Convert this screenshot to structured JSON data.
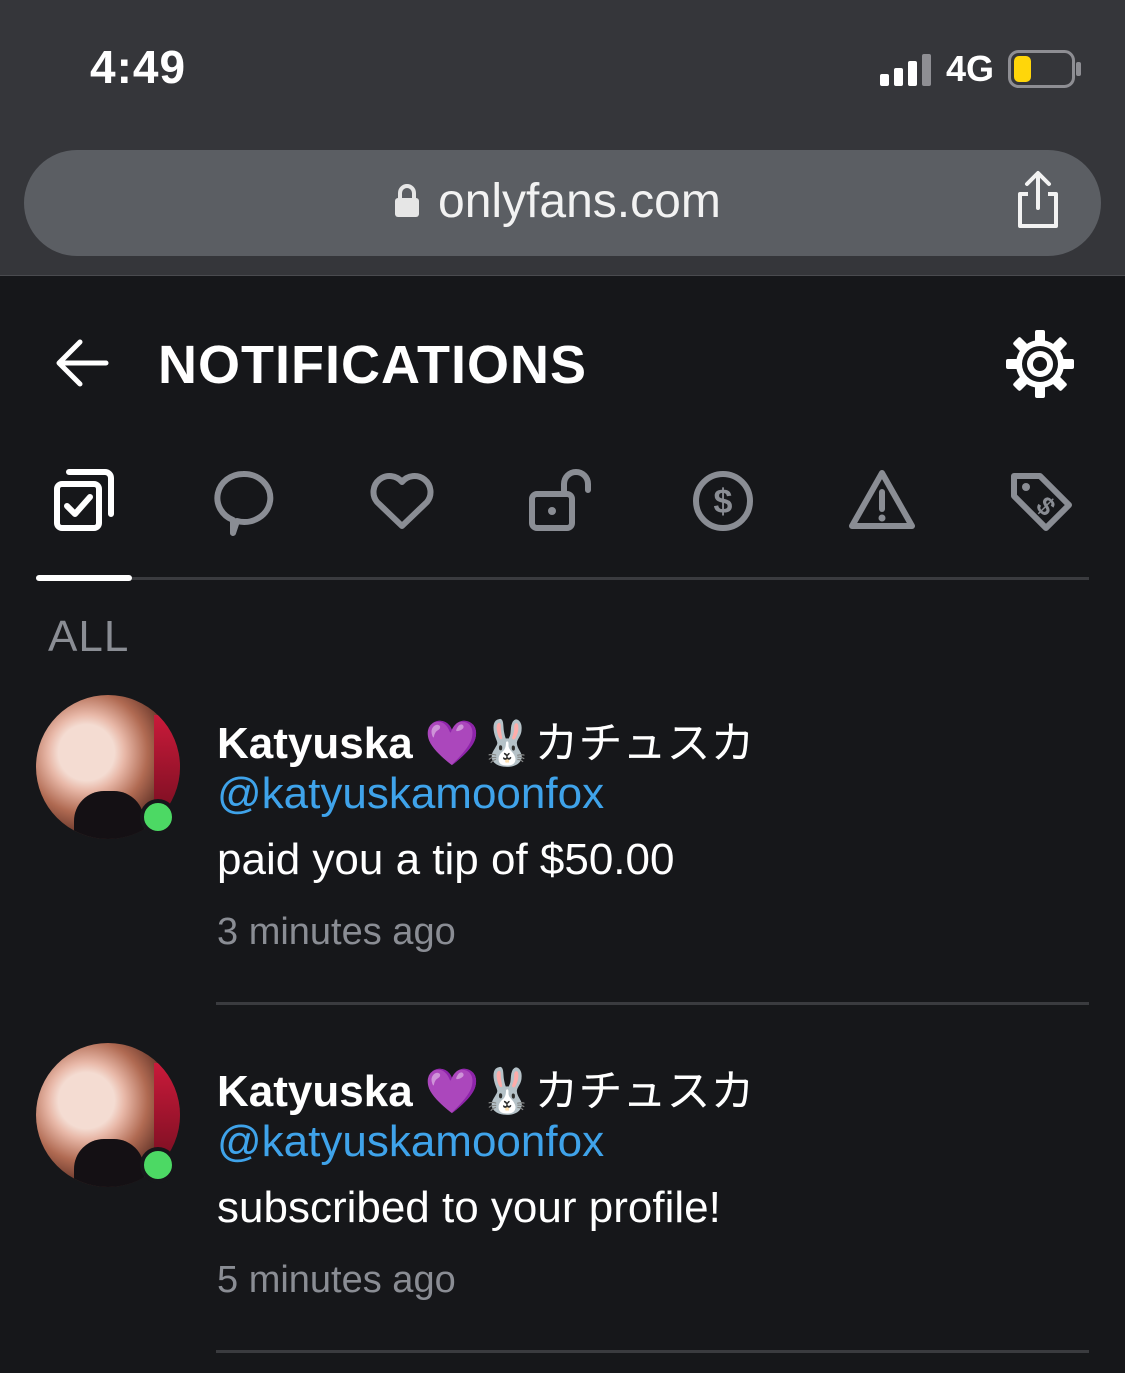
{
  "status_bar": {
    "time": "4:49",
    "network": "4G",
    "battery_level": 0.3,
    "battery_color": "#ffd60a"
  },
  "browser": {
    "url": "onlyfans.com",
    "lock_icon": "lock-icon",
    "share_icon": "share-icon"
  },
  "header": {
    "title": "NOTIFICATIONS",
    "back_icon": "back-arrow-icon",
    "settings_icon": "gear-icon"
  },
  "tabs": [
    {
      "name": "all",
      "icon": "checkbox-stack-icon",
      "active": true
    },
    {
      "name": "comments",
      "icon": "chat-bubble-icon",
      "active": false
    },
    {
      "name": "likes",
      "icon": "heart-icon",
      "active": false
    },
    {
      "name": "subscriptions",
      "icon": "unlock-icon",
      "active": false
    },
    {
      "name": "tips",
      "icon": "dollar-circle-icon",
      "active": false
    },
    {
      "name": "alerts",
      "icon": "warning-icon",
      "active": false
    },
    {
      "name": "promotions",
      "icon": "price-tag-icon",
      "active": false
    }
  ],
  "section": {
    "label": "ALL"
  },
  "notifications": [
    {
      "name": "Katyuska",
      "name_suffix": "カチュスカ",
      "emoji": [
        "💜",
        "🐰"
      ],
      "handle": "@katyuskamoonfox",
      "message": "paid you a tip of $50.00",
      "time": "3 minutes ago",
      "online": true
    },
    {
      "name": "Katyuska",
      "name_suffix": "カチュスカ",
      "emoji": [
        "💜",
        "🐰"
      ],
      "handle": "@katyuskamoonfox",
      "message": "subscribed to your profile!",
      "time": "5 minutes ago",
      "online": true
    }
  ],
  "colors": {
    "background": "#16171a",
    "chrome": "#35363a",
    "link": "#3fa3ea",
    "muted": "#8a8d94",
    "online": "#4cd964"
  }
}
